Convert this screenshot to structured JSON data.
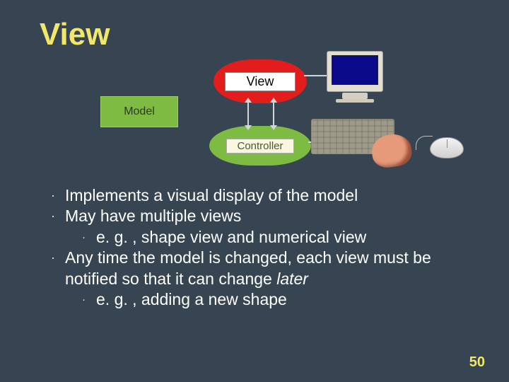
{
  "title": "View",
  "diagram": {
    "model": "Model",
    "view": "View",
    "controller": "Controller"
  },
  "bullets": [
    {
      "text": "Implements a visual display of the model"
    },
    {
      "text": "May have multiple views",
      "sub": [
        "e. g. , shape view and numerical view"
      ]
    },
    {
      "text_html": "Any time the model is changed, each view must be notified so that it can change <em>later</em>",
      "sub": [
        "e. g. , adding a new shape"
      ]
    }
  ],
  "page_number": "50"
}
